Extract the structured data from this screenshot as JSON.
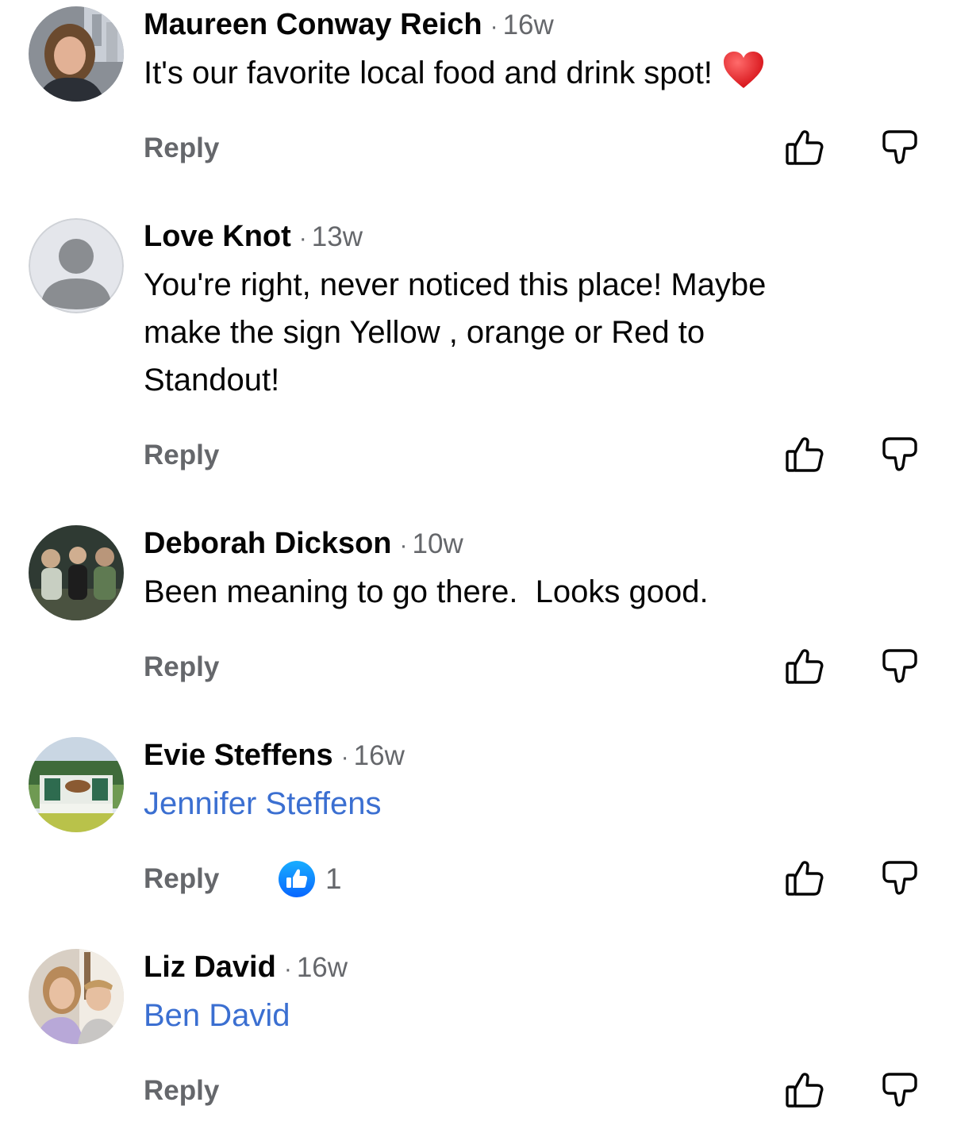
{
  "comments": [
    {
      "author": "Maureen Conway Reich",
      "time": "16w",
      "text": "It's our favorite local food and drink spot!",
      "emoji": "red-heart",
      "reply_label": "Reply"
    },
    {
      "author": "Love Knot",
      "time": "13w",
      "text_lines": [
        "You're right, never noticed this place! Maybe",
        "make the sign Yellow , orange or Red to",
        "Standout!"
      ],
      "reply_label": "Reply"
    },
    {
      "author": "Deborah Dickson",
      "time": "10w",
      "text": "Been meaning to go there.  Looks good.",
      "reply_label": "Reply"
    },
    {
      "author": "Evie Steffens",
      "time": "16w",
      "mention": "Jennifer Steffens",
      "reply_label": "Reply",
      "reaction_count": "1"
    },
    {
      "author": "Liz David",
      "time": "16w",
      "mention": "Ben David",
      "reply_label": "Reply"
    }
  ],
  "separator": "·",
  "icons": {
    "like": "thumbs-up-outline-icon",
    "dislike": "thumbs-down-outline-icon",
    "reaction": "like-reaction-badge-icon",
    "heart": "red-heart-emoji"
  },
  "colors": {
    "text": "#050505",
    "secondary": "#65676b",
    "mention": "#3b6fd1",
    "like_blue": "#1877f2"
  }
}
